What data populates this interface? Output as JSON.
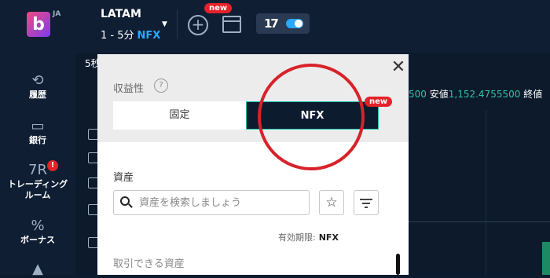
{
  "header": {
    "logo_letter": "b",
    "lang": "JA",
    "asset_name": "LATAM",
    "asset_time": "1 - 5分",
    "asset_mode": "NFX",
    "new_badge": "new"
  },
  "sidebar": {
    "items": [
      {
        "label": "履歴",
        "icon": "history-icon"
      },
      {
        "label": "銀行",
        "icon": "wallet-icon"
      },
      {
        "label": "トレーディング\nルーム",
        "icon": "trading-room-icon",
        "badge": "!",
        "icon_text": "7R"
      },
      {
        "label": "ボーナス",
        "icon": "percent-icon",
        "icon_text": "%"
      }
    ]
  },
  "chart": {
    "tab_partial": "5秒",
    "stats_prefix_value": "500",
    "low_label": "安値",
    "low_value": "1,152.4755500",
    "close_label": "終値"
  },
  "panel": {
    "profitability_title": "収益性",
    "help": "?",
    "segments": [
      "固定",
      "NFX"
    ],
    "selected_segment": "NFX",
    "nfx_badge": "new",
    "assets_title": "資産",
    "search_placeholder": "資産を検索しましょう",
    "expiry_label": "有効期限:",
    "expiry_value": "NFX",
    "tradeable_assets": "取引できる資産"
  },
  "colors": {
    "background": "#0d1b2e",
    "accent_blue": "#2aa8ff",
    "badge_red": "#e3222a",
    "stat_green": "#2fc4a0",
    "annotation_red": "#d8222a"
  }
}
